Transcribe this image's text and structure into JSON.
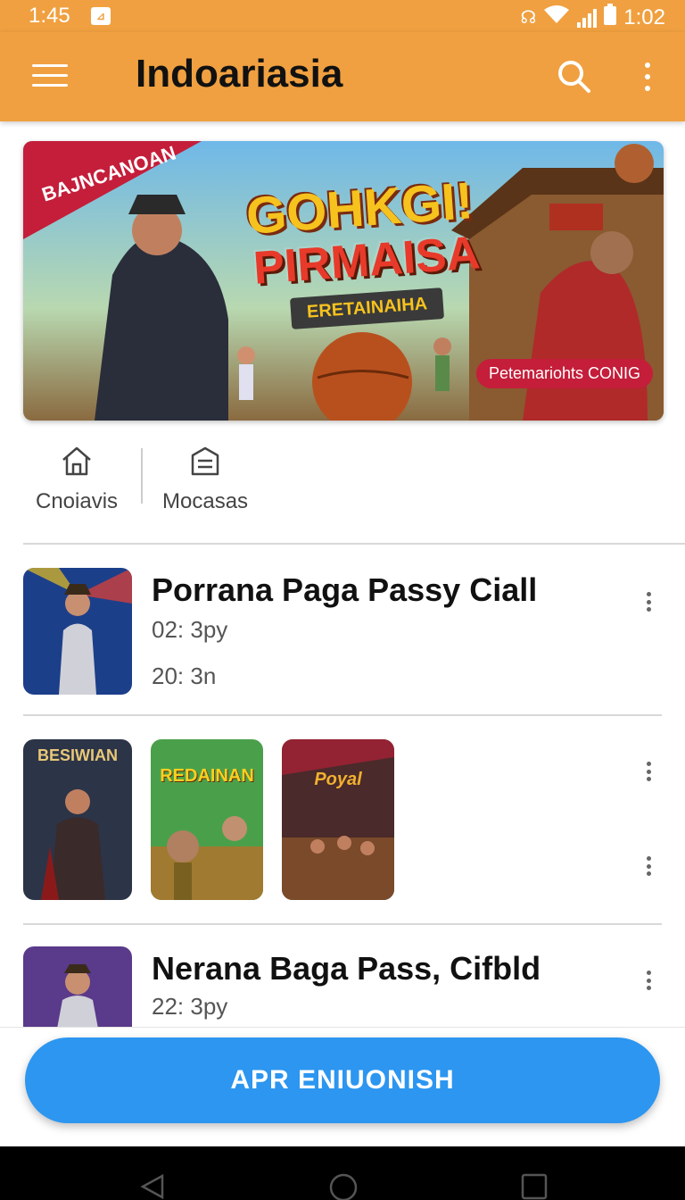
{
  "status_bar": {
    "time_left": "1:45",
    "time_right": "1:02",
    "notification_icon": "app-notification-icon"
  },
  "app_bar": {
    "title": "Indoariasia",
    "menu_icon": "hamburger-menu-icon",
    "search_icon": "search-icon",
    "more_icon": "overflow-menu-icon"
  },
  "banner": {
    "ribbon": "BAJNCANOAN",
    "title_line1": "GOHKGI!",
    "title_line2": "PIRMAISA",
    "subtitle": "ERETAINAIHA",
    "pill": "Petemariohts CONIG"
  },
  "quick_links": [
    {
      "label": "Cnoiavis",
      "icon": "home-icon"
    },
    {
      "label": "Mocasas",
      "icon": "inbox-icon"
    }
  ],
  "rows": [
    {
      "title": "Porrana Paga Passy Ciall",
      "meta1": "02: 3py",
      "meta2": "20: 3n"
    },
    {
      "thumb_labels": [
        "BESIWIAN",
        "REDAINAN",
        "Poyal"
      ]
    },
    {
      "title": "Nerana Baga Pass, Cifbld",
      "meta1": "22: 3py"
    }
  ],
  "cta": {
    "label": "APR ENIUONISH"
  },
  "colors": {
    "appbar": "#f0a040",
    "cta": "#2c96f0",
    "pill": "#c41e3a"
  }
}
